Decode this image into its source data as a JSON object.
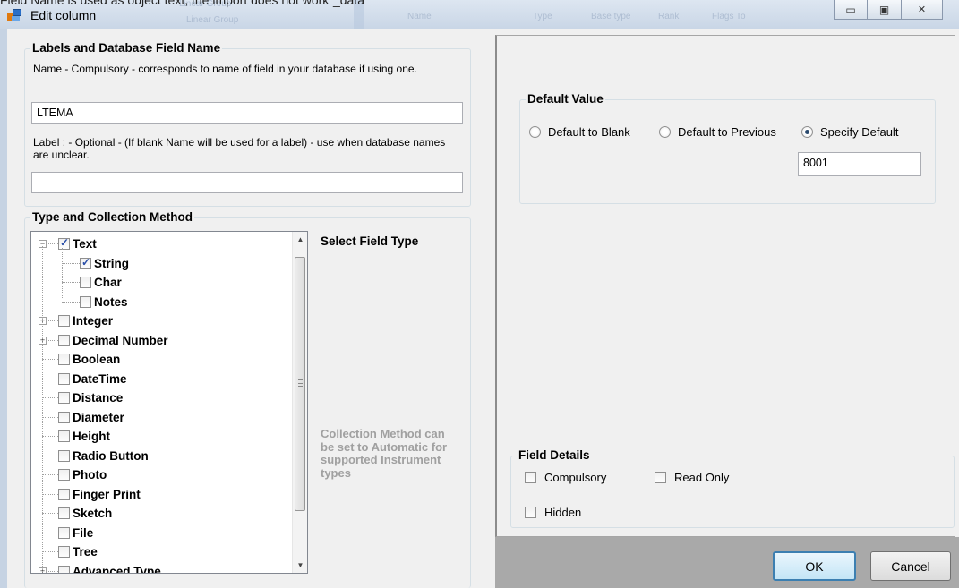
{
  "window": {
    "title": "Edit column",
    "clipped_text": "Field Name is used as object text, the import does not work“_data”",
    "ghost_headers": [
      "Linear Group",
      "Name",
      "Type",
      "Base type",
      "Rank",
      "Flags To"
    ]
  },
  "labels_group": {
    "title": "Labels and Database Field Name",
    "name_help": "Name - Compulsory - corresponds  to  name of field in your database if using one.",
    "name_value": "LTEMA",
    "label_help": "Label : - Optional - (If blank  Name will be used for a label) - use when database names are unclear.",
    "label_value": ""
  },
  "type_group": {
    "title": "Type and Collection Method",
    "select_hint": "Select Field Type",
    "collection_hint": "Collection Method can be set to Automatic for supported Instrument types",
    "tree": [
      {
        "label": "Text",
        "level": 0,
        "expander": "minus",
        "checked": true
      },
      {
        "label": "String",
        "level": 1,
        "expander": "",
        "checked": true
      },
      {
        "label": "Char",
        "level": 1,
        "expander": "",
        "checked": false
      },
      {
        "label": "Notes",
        "level": 1,
        "expander": "",
        "checked": false
      },
      {
        "label": "Integer",
        "level": 0,
        "expander": "plus",
        "checked": false
      },
      {
        "label": "Decimal Number",
        "level": 0,
        "expander": "plus",
        "checked": false
      },
      {
        "label": "Boolean",
        "level": 0,
        "expander": "",
        "checked": false
      },
      {
        "label": "DateTime",
        "level": 0,
        "expander": "",
        "checked": false
      },
      {
        "label": "Distance",
        "level": 0,
        "expander": "",
        "checked": false
      },
      {
        "label": "Diameter",
        "level": 0,
        "expander": "",
        "checked": false
      },
      {
        "label": "Height",
        "level": 0,
        "expander": "",
        "checked": false
      },
      {
        "label": "Radio Button",
        "level": 0,
        "expander": "",
        "checked": false
      },
      {
        "label": "Photo",
        "level": 0,
        "expander": "",
        "checked": false
      },
      {
        "label": "Finger Print",
        "level": 0,
        "expander": "",
        "checked": false
      },
      {
        "label": "Sketch",
        "level": 0,
        "expander": "",
        "checked": false
      },
      {
        "label": "File",
        "level": 0,
        "expander": "",
        "checked": false
      },
      {
        "label": "Tree",
        "level": 0,
        "expander": "",
        "checked": false
      },
      {
        "label": "Advanced Type",
        "level": 0,
        "expander": "plus",
        "checked": false
      }
    ]
  },
  "default_value": {
    "title": "Default Value",
    "options": [
      "Default to Blank",
      "Default to Previous",
      "Specify Default"
    ],
    "selected": "Specify Default",
    "value": "8001"
  },
  "field_details": {
    "title": "Field Details",
    "compulsory": "Compulsory",
    "read_only": "Read Only",
    "hidden": "Hidden"
  },
  "buttons": {
    "ok": "OK",
    "cancel": "Cancel"
  }
}
